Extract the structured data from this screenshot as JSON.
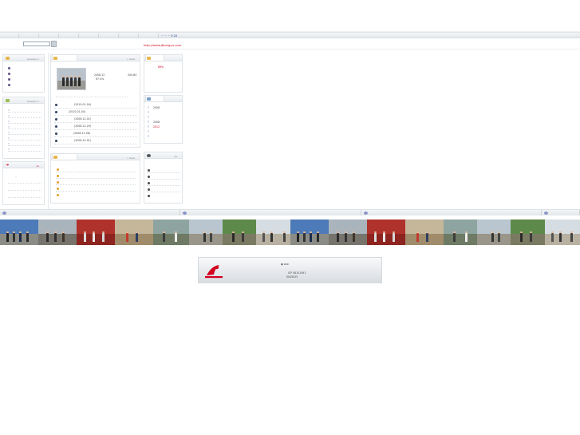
{
  "header": {
    "nav_items": [
      "",
      "",
      "",
      "",
      "",
      "",
      "",
      ""
    ],
    "date_text": "~ ~ ~ 5:28"
  },
  "search": {
    "placeholder": "",
    "button_label": ""
  },
  "site": {
    "url": "http://www.jblongyu.com"
  },
  "left_panels": {
    "panel1": {
      "title": "",
      "more": "ooooooo ×",
      "items": [
        "",
        "",
        "",
        ""
      ]
    },
    "panel2": {
      "title": "",
      "more": "ooooooo ×",
      "items": [
        "",
        "",
        "",
        "",
        "",
        "",
        "",
        ""
      ]
    },
    "panel3": {
      "title": "",
      "more": "oo",
      "body": ".."
    }
  },
  "center": {
    "featured": {
      "more": "» more",
      "date": "2008-12",
      "views": "200-84",
      "percent": "67.4%"
    },
    "news": [
      {
        "title": "",
        "date": "(2010-01-04)"
      },
      {
        "title": "",
        "date": "(2010-01-04)"
      },
      {
        "title": "",
        "date": "(2008-12-01)"
      },
      {
        "title": "",
        "date": "(2008-12-29)"
      },
      {
        "title": "",
        "date": "(2008-12-08)"
      },
      {
        "title": "",
        "date": "(2008-12-01)"
      }
    ],
    "notices": {
      "more": "» more",
      "items": [
        "",
        "",
        "",
        "",
        ""
      ]
    }
  },
  "right_panels": {
    "panel1": {
      "percent": "89%"
    },
    "panel2": {
      "rows": [
        {
          "year": "2008",
          "highlight": false
        },
        {
          "year": "",
          "highlight": false
        },
        {
          "year": "",
          "highlight": false
        },
        {
          "year": "2008",
          "highlight": false
        },
        {
          "year": "2012",
          "highlight": true
        },
        {
          "year": "",
          "highlight": false
        },
        {
          "year": "",
          "highlight": false
        }
      ]
    },
    "panel3": {
      "more": "oo",
      "items": [
        "",
        "",
        "",
        "",
        ""
      ]
    }
  },
  "footer": {
    "links_label": "◉ ooo",
    "icp": "ICP 08101491",
    "record": "0045023"
  },
  "colors": {
    "accent_red": "#d2001f",
    "nav_blue": "#2a4f9a",
    "panel_border": "#dfe4e9"
  }
}
